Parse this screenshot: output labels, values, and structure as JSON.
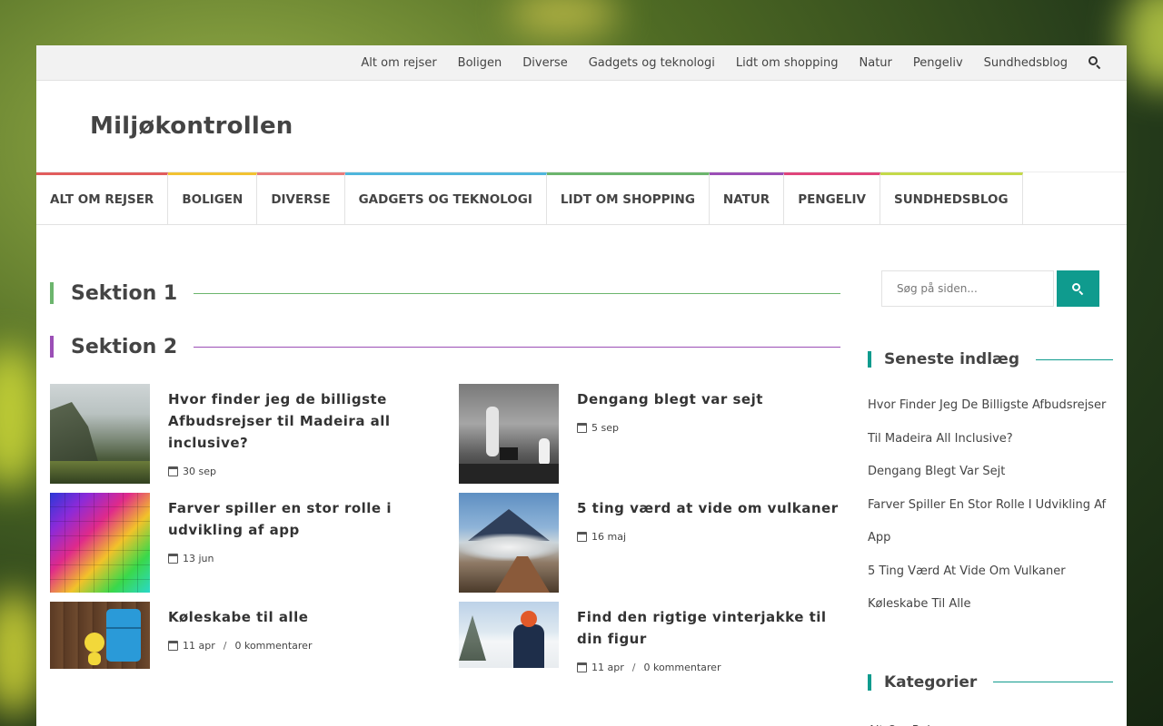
{
  "topbar": {
    "links": [
      "Alt om rejser",
      "Boligen",
      "Diverse",
      "Gadgets og teknologi",
      "Lidt om shopping",
      "Natur",
      "Pengeliv",
      "Sundhedsblog"
    ]
  },
  "site": {
    "title": "Miljøkontrollen"
  },
  "mainnav": {
    "items": [
      {
        "label": "ALT OM REJSER",
        "color": "#e25d5d"
      },
      {
        "label": "BOLIGEN",
        "color": "#f2c232"
      },
      {
        "label": "DIVERSE",
        "color": "#e87b7b"
      },
      {
        "label": "GADGETS OG TEKNOLOGI",
        "color": "#4fb6dc"
      },
      {
        "label": "LIDT OM SHOPPING",
        "color": "#6cb56d"
      },
      {
        "label": "NATUR",
        "color": "#9b4fb6"
      },
      {
        "label": "PENGELIV",
        "color": "#e0457b"
      },
      {
        "label": "SUNDHEDSBLOG",
        "color": "#c4d94a"
      }
    ]
  },
  "sections": [
    {
      "title": "Sektion 1",
      "color": "#6cb56d"
    },
    {
      "title": "Sektion 2",
      "color": "#9b4fb6"
    }
  ],
  "posts": [
    {
      "title": "Hvor finder jeg de billigste Afbudsrejser til Madeira all inclusive?",
      "date": "30 sep",
      "comments": "",
      "image": "cliffs"
    },
    {
      "title": "Dengang blegt var sejt",
      "date": "5 sep",
      "comments": "",
      "image": "bw-photo"
    },
    {
      "title": "Farver spiller en stor rolle i udvikling af app",
      "date": "13 jun",
      "comments": "",
      "image": "color-cubes"
    },
    {
      "title": "5 ting værd at vide om vulkaner",
      "date": "16 maj",
      "comments": "",
      "image": "volcano"
    },
    {
      "title": "Køleskabe til alle",
      "date": "11 apr",
      "comments": "0 kommentarer",
      "image": "fridge"
    },
    {
      "title": "Find den rigtige vinterjakke til din figur",
      "date": "11 apr",
      "comments": "0 kommentarer",
      "image": "winter"
    }
  ],
  "sidebar": {
    "search_placeholder": "Søg på siden...",
    "recent_title": "Seneste indlæg",
    "recent": [
      "Hvor Finder Jeg De Billigste Afbudsrejser Til Madeira All Inclusive?",
      "Dengang Blegt Var Sejt",
      "Farver Spiller En Stor Rolle I Udvikling Af App",
      "5 Ting Værd At Vide Om Vulkaner",
      "Køleskabe Til Alle"
    ],
    "categories_title": "Kategorier",
    "categories": [
      "Alt Om Rejser"
    ]
  },
  "colors": {
    "accent": "#0f9b8e"
  }
}
